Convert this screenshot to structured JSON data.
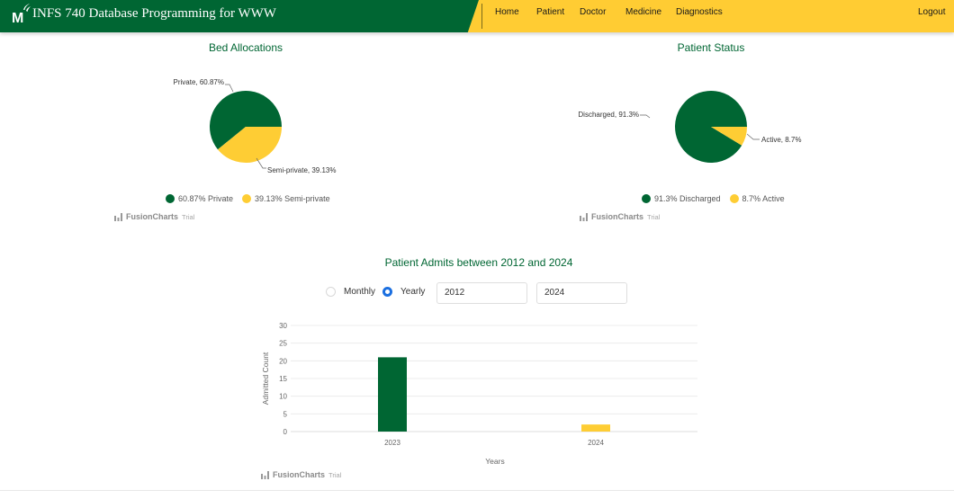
{
  "header": {
    "brand_title": "INFS 740 Database Programming for WWW",
    "nav": [
      "Home",
      "Patient",
      "Doctor",
      "Medicine",
      "Diagnostics"
    ],
    "logout_label": "Logout"
  },
  "colors": {
    "primary_green": "#006633",
    "accent_gold": "#ffcc33",
    "chart_green": "#006633",
    "chart_yellow": "#fecd34",
    "radio_blue": "#1b6fe0"
  },
  "fusioncharts": {
    "brand": "FusionCharts",
    "suffix": "Trial"
  },
  "icons": {
    "logo": "mason-m-logo",
    "watermark": "fusioncharts-bar-icon"
  },
  "bed_allocations": {
    "title": "Bed Allocations",
    "legend": [
      "60.87% Private",
      "39.13% Semi-private"
    ]
  },
  "patient_status": {
    "title": "Patient Status",
    "legend": [
      "91.3% Discharged",
      "8.7% Active"
    ]
  },
  "admits": {
    "title": "Patient Admits between 2012 and 2024",
    "monthly_label": "Monthly",
    "yearly_label": "Yearly",
    "selected_mode": "Yearly",
    "start_year": "2012",
    "end_year": "2024"
  },
  "chart_data": [
    {
      "type": "pie",
      "title": "Bed Allocations",
      "labels": [
        "Private",
        "Semi-private"
      ],
      "values": [
        60.87,
        39.13
      ],
      "slice_labels": [
        "Private, 60.87%",
        "Semi-private, 39.13%"
      ],
      "colors": [
        "#006633",
        "#fecd34"
      ],
      "legend": "bottom"
    },
    {
      "type": "pie",
      "title": "Patient Status",
      "labels": [
        "Discharged",
        "Active"
      ],
      "values": [
        91.3,
        8.7
      ],
      "slice_labels": [
        "Discharged, 91.3%",
        "Active, 8.7%"
      ],
      "colors": [
        "#006633",
        "#fecd34"
      ],
      "legend": "bottom"
    },
    {
      "type": "bar",
      "categories": [
        "2023",
        "2024"
      ],
      "values": [
        21,
        2
      ],
      "colors": [
        "#006633",
        "#fecd34"
      ],
      "xlabel": "Years",
      "ylabel": "Admitted Count",
      "ylim": [
        0,
        30
      ],
      "yticks": [
        0,
        5,
        10,
        15,
        20,
        25,
        30
      ],
      "grid": true
    }
  ]
}
